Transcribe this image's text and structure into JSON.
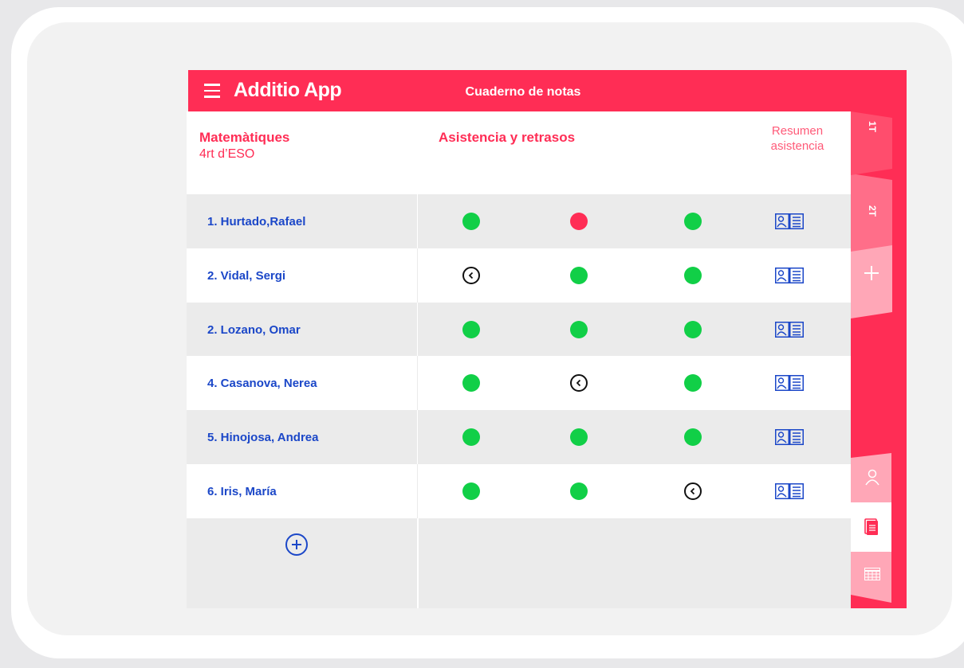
{
  "app": {
    "brand": "Additio App",
    "title": "Cuaderno de notas"
  },
  "header": {
    "subject": "Matemàtiques",
    "course": "4rt d’ESO",
    "section_title": "Asistencia y retrasos",
    "summary_line1": "Resumen",
    "summary_line2": "asistencia"
  },
  "tabs": [
    {
      "label": "1T"
    },
    {
      "label": "2T"
    },
    {
      "label": "+"
    }
  ],
  "students": [
    {
      "name": "1. Hurtado,Rafael",
      "attendance": [
        "present",
        "absent",
        "present"
      ]
    },
    {
      "name": "2. Vidal, Sergi",
      "attendance": [
        "late",
        "present",
        "present"
      ]
    },
    {
      "name": "2. Lozano, Omar",
      "attendance": [
        "present",
        "present",
        "present"
      ]
    },
    {
      "name": "4. Casanova, Nerea",
      "attendance": [
        "present",
        "late",
        "present"
      ]
    },
    {
      "name": "5. Hinojosa, Andrea",
      "attendance": [
        "present",
        "present",
        "present"
      ]
    },
    {
      "name": "6.  Iris, María",
      "attendance": [
        "present",
        "present",
        "late"
      ]
    }
  ],
  "icons": {
    "menu": "hamburger-menu-icon",
    "summary": "student-card-icon",
    "add": "plus-circle-icon",
    "side": [
      "user-icon",
      "document-icon",
      "grid-icon"
    ]
  },
  "colors": {
    "brand": "#ff2d55",
    "present": "#11cf47",
    "absent": "#ff2d55",
    "name": "#1b47c8"
  }
}
